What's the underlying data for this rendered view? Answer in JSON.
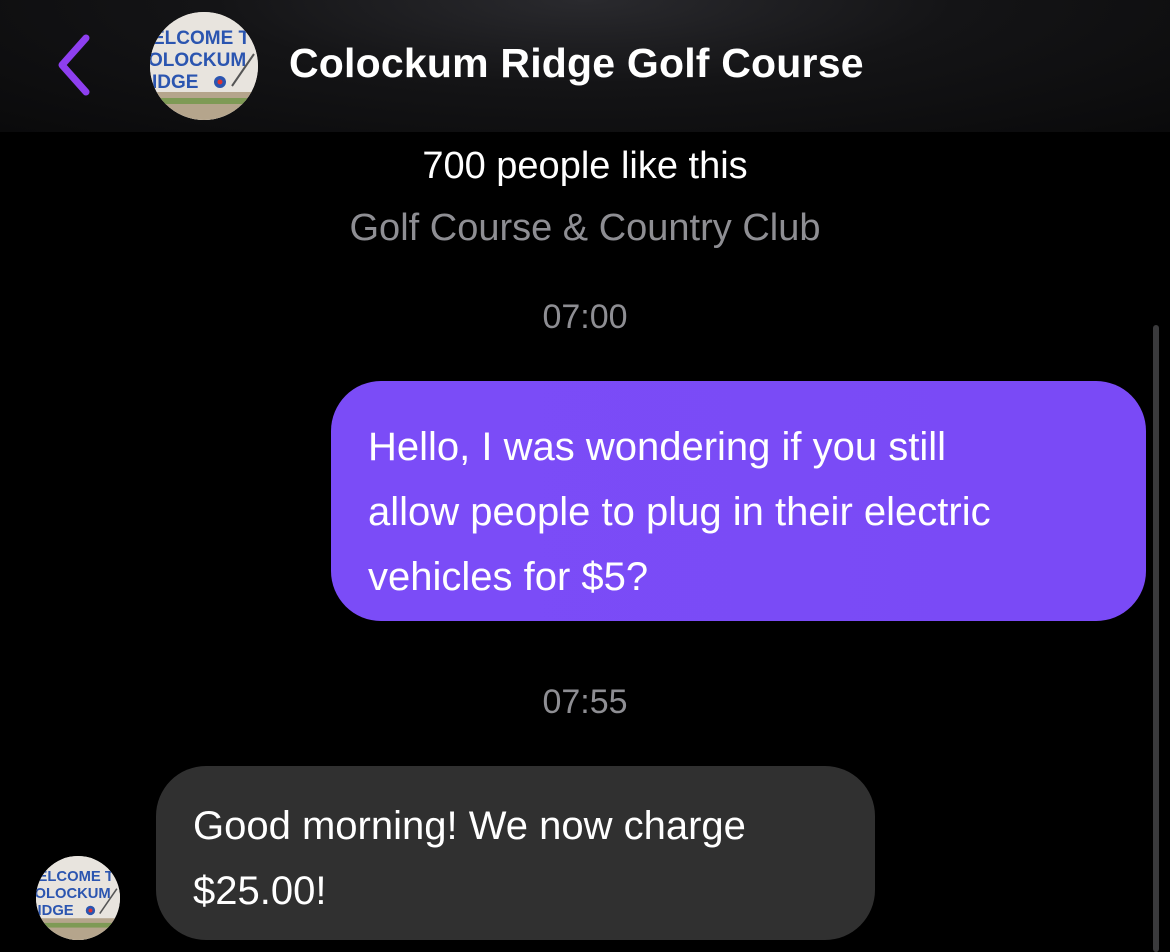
{
  "header": {
    "title": "Colockum Ridge Golf Course",
    "back_icon": "chevron-left-icon",
    "accent_color": "#8e3ff0",
    "avatar_sign_lines": [
      "ELCOME T",
      "OLOCKUM",
      "IDGE"
    ]
  },
  "profile": {
    "likes": "700 people like this",
    "category": "Golf Course & Country Club"
  },
  "messages": [
    {
      "timestamp": "07:00",
      "direction": "outgoing",
      "lines": [
        "Hello, I was wondering if you still",
        "allow people to plug in their electric",
        "vehicles for $5?"
      ],
      "bubble_color": "#7b4cf7"
    },
    {
      "timestamp": "07:55",
      "direction": "incoming",
      "lines": [
        "Good morning! We now charge",
        "$25.00!"
      ],
      "bubble_color": "#303030"
    }
  ]
}
